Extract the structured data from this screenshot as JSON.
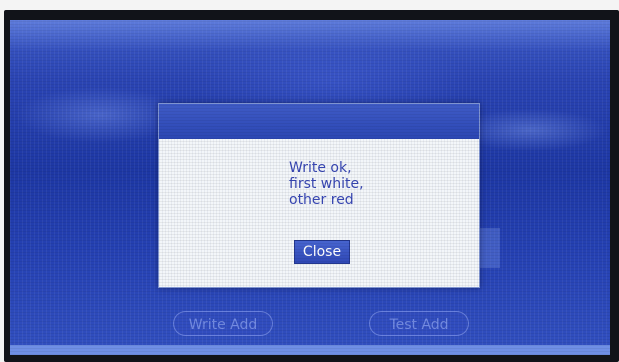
{
  "dialog": {
    "message_lines": [
      "Write ok,",
      "first white,",
      "other red"
    ],
    "close_label": "Close"
  },
  "background_buttons": {
    "write_add_label": "Write Add",
    "test_add_label": "Test Add"
  },
  "colors": {
    "screen_blue": "#2a44b3",
    "dialog_background": "#f3f6f9",
    "message_text": "#3746b2",
    "button_blue": "#3a55c2"
  }
}
